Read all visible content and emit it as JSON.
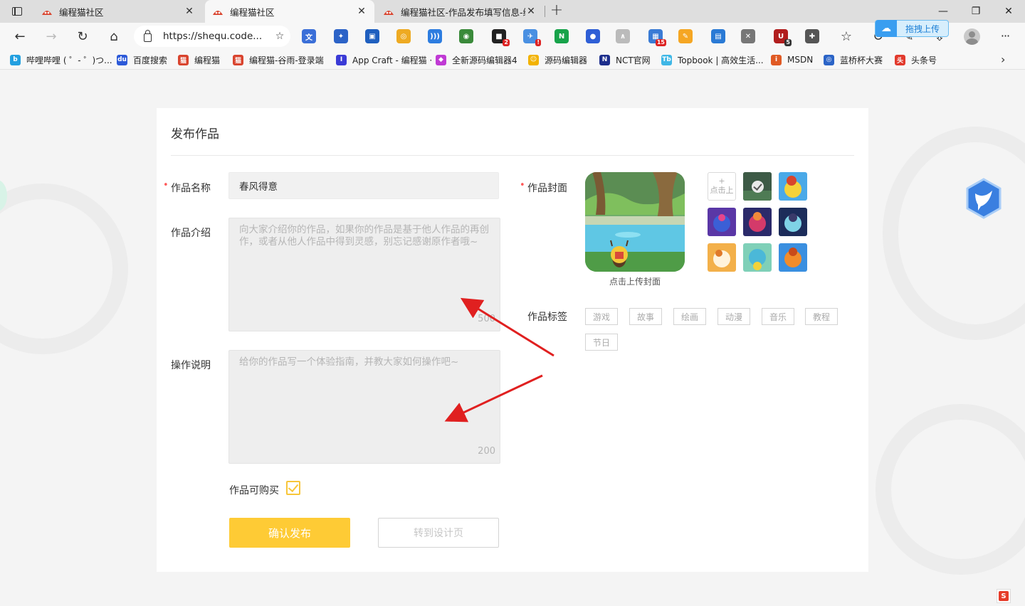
{
  "browser": {
    "tabs": [
      {
        "title": "编程猫社区",
        "active": false
      },
      {
        "title": "编程猫社区",
        "active": true
      },
      {
        "title": "编程猫社区-作品发布填写信息-编",
        "active": false
      }
    ],
    "address": "https://shequ.code...",
    "extensions": [
      {
        "name": "translate-ext",
        "color": "#3b6fd8",
        "glyph": "文",
        "badge": ""
      },
      {
        "name": "puzzle-blue-ext",
        "color": "#2c63c7",
        "glyph": "✦",
        "badge": ""
      },
      {
        "name": "image-ext",
        "color": "#1f5fbf",
        "glyph": "▣",
        "badge": ""
      },
      {
        "name": "ring-ext",
        "color": "#eeaa22",
        "glyph": "◎",
        "badge": ""
      },
      {
        "name": "signal-ext",
        "color": "#2d7de0",
        "glyph": ")))",
        "badge": ""
      },
      {
        "name": "globe-ext",
        "color": "#3a8a3a",
        "glyph": "◉",
        "badge": ""
      },
      {
        "name": "chat-ext",
        "color": "#222222",
        "glyph": "■",
        "badge": "2"
      },
      {
        "name": "bird-ext",
        "color": "#4a90e2",
        "glyph": "✈",
        "badge": "!"
      },
      {
        "name": "n-ext",
        "color": "#17a34a",
        "glyph": "N",
        "badge": ""
      },
      {
        "name": "circle-ext",
        "color": "#2f5fd6",
        "glyph": "●",
        "badge": ""
      },
      {
        "name": "mountain-ext",
        "color": "#bbbbbb",
        "glyph": "∧",
        "badge": ""
      },
      {
        "name": "grid-ext",
        "color": "#3a7bd5",
        "glyph": "▦",
        "badge": "15"
      },
      {
        "name": "tool-ext",
        "color": "#f5a623",
        "glyph": "✎",
        "badge": ""
      },
      {
        "name": "screenshot-ext",
        "color": "#2a7ad5",
        "glyph": "▤",
        "badge": ""
      },
      {
        "name": "compass-ext",
        "color": "#777777",
        "glyph": "✕",
        "badge": ""
      },
      {
        "name": "shield-ext",
        "color": "#b11e1e",
        "glyph": "U",
        "badge": "5"
      },
      {
        "name": "puzzle-ext",
        "color": "#555555",
        "glyph": "✚",
        "badge": ""
      }
    ],
    "upload_pill": "拖拽上传",
    "bookmarks": [
      {
        "label": "哔哩哔哩 ( ゜- ゜)つ...",
        "color": "#23a0e0",
        "glyph": "b"
      },
      {
        "label": "百度搜索",
        "color": "#2d5ad8",
        "glyph": "du"
      },
      {
        "label": "编程猫",
        "color": "#d9442e",
        "glyph": "猫"
      },
      {
        "label": "编程猫-谷雨-登录端",
        "color": "#d9442e",
        "glyph": "猫"
      },
      {
        "label": "App Craft - 编程猫 ·",
        "color": "#3b3bd6",
        "glyph": "I"
      },
      {
        "label": "全新源码编辑器4",
        "color": "#c03ad4",
        "glyph": "◆"
      },
      {
        "label": "源码编辑器",
        "color": "#f2b200",
        "glyph": "☺"
      },
      {
        "label": "NCT官网",
        "color": "#1d2e8c",
        "glyph": "N"
      },
      {
        "label": "Topbook | 高效生活...",
        "color": "#3fb7e6",
        "glyph": "Tb"
      },
      {
        "label": "MSDN",
        "color": "#e05a24",
        "glyph": "i"
      },
      {
        "label": "蓝桥杯大赛",
        "color": "#2b64c7",
        "glyph": "◎"
      },
      {
        "label": "头条号",
        "color": "#e23a2d",
        "glyph": "头"
      }
    ]
  },
  "form": {
    "title": "发布作品",
    "name_label": "作品名称",
    "name_value": "春风得意",
    "intro_label": "作品介绍",
    "intro_placeholder": "向大家介绍你的作品，如果你的作品是基于他人作品的再创作，或者从他人作品中得到灵感，别忘记感谢原作者哦~",
    "intro_counter": "500",
    "guide_label": "操作说明",
    "guide_placeholder": "给你的作品写一个体验指南，并教大家如何操作吧~",
    "guide_counter": "200",
    "purchasable_label": "作品可购买",
    "purchasable_checked": true,
    "confirm_button": "确认发布",
    "design_button": "转到设计页",
    "cover_label": "作品封面",
    "cover_caption": "点击上传封面",
    "thumb_add_plus": "+",
    "thumb_add_text": "点击上",
    "tags_label": "作品标签",
    "tags": [
      "游戏",
      "故事",
      "绘画",
      "动漫",
      "音乐",
      "教程",
      "节日"
    ]
  },
  "colors": {
    "accent": "#fecb35",
    "required_dot": "#ff5a5a",
    "annotation_arrow": "#e02020"
  }
}
